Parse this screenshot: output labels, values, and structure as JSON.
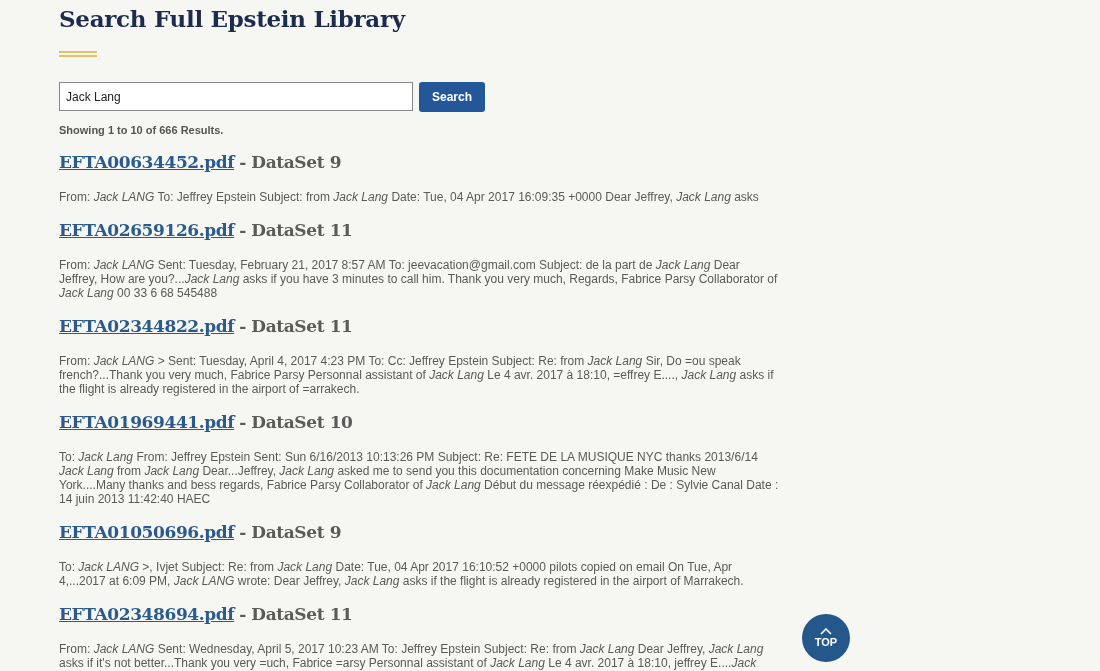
{
  "page_title": "Search Full Epstein Library",
  "search": {
    "value": "Jack Lang",
    "button": "Search"
  },
  "results_summary": "Showing 1 to 10 of 666 Results.",
  "results": [
    {
      "file": "EFTA00634452.pdf",
      "dataset": "- DataSet 9",
      "snippet": "From: *Jack LANG* To: Jeffrey Epstein Subject: from *Jack Lang* Date: Tue, 04 Apr 2017 16:09:35 +0000 Dear Jeffrey, *Jack Lang* asks"
    },
    {
      "file": "EFTA02659126.pdf",
      "dataset": "- DataSet 11",
      "snippet": "From: *Jack LANG* Sent: Tuesday, February 21, 2017 8:57 AM To: jeevacation@gmail.com Subject: de la part de *Jack Lang* Dear Jeffrey, How are you?...*Jack Lang* asks if you have 3 minutes to call him. Thank you very much, Regards, Fabrice Parsy Collaborator of *Jack Lang* 00 33 6 68 545488"
    },
    {
      "file": "EFTA02344822.pdf",
      "dataset": "- DataSet 11",
      "snippet": "From: *Jack LANG* > Sent: Tuesday, April 4, 2017 4:23 PM To: Cc: Jeffrey Epstein Subject: Re: from *Jack Lang* Sir, Do =ou speak french?...Thank you very much, Fabrice Parsy Personnal assistant of *Jack Lang* Le 4 avr. 2017 à 18:10, =effrey E...., *Jack Lang* asks if the flight is already registered in the airport of =arrakech."
    },
    {
      "file": "EFTA01969441.pdf",
      "dataset": "- DataSet 10",
      "snippet": "To: *Jack Lang* From: Jeffrey Epstein Sent: Sun 6/16/2013 10:13:26 PM Subject: Re: FETE DE LA MUSIQUE NYC thanks 2013/6/14 *Jack Lang* from *Jack Lang* Dear...Jeffrey, *Jack Lang* asked me to send you this documentation concerning Make Music New York....Many thanks and bess regards, Fabrice Parsy Collaborator of *Jack Lang* Début du message réexpédié : De : Sylvie Canal Date : 14 juin 2013 11:42:40 HAEC"
    },
    {
      "file": "EFTA01050696.pdf",
      "dataset": "- DataSet 9",
      "snippet": "To: *Jack LANG* >, Ivjet Subject: Re: from *Jack Lang* Date: Tue, 04 Apr 2017 16:10:52 +0000 pilots copied on email On Tue, Apr 4,...2017 at 6:09 PM, *Jack LANG* wrote: Dear Jeffrey, *Jack Lang* asks if the flight is already registered in the airport of Marrakech."
    },
    {
      "file": "EFTA02348694.pdf",
      "dataset": "- DataSet 11",
      "snippet": "From: *Jack LANG* Sent: Wednesday, April 5, 2017 10:23 AM To: Jeffrey Epstein Subject: Re: from *Jack Lang* Dear Jeffrey, *Jack Lang* asks if it's not better...Thank you very =uch, Fabrice =arsy Personnal assistant of *Jack Lang* Le 4 avr. 2017 à 18:10, jeffrey E....*Jack*"
    }
  ],
  "top_button": "TOP"
}
